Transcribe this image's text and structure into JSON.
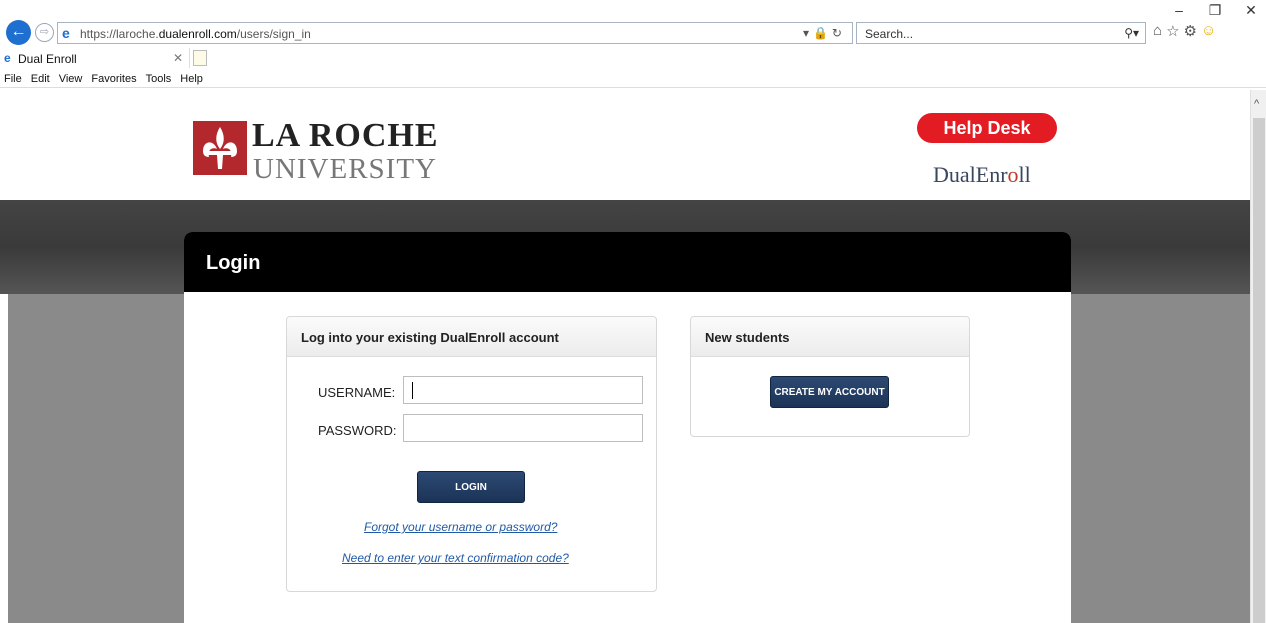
{
  "browser": {
    "url_prefix": "https://laroche.",
    "url_domain": "dualenroll.com",
    "url_path": "/users/sign_in",
    "search_placeholder": "Search...",
    "tab_title": "Dual Enroll",
    "menu": [
      "File",
      "Edit",
      "View",
      "Favorites",
      "Tools",
      "Help"
    ]
  },
  "header": {
    "logo_line1": "LA ROCHE",
    "logo_line2": "UNIVERSITY",
    "help_desk": "Help Desk",
    "brand_prefix": "DualEnr",
    "brand_o": "o",
    "brand_suffix": "ll"
  },
  "login": {
    "title": "Login",
    "panel_title": "Log into your existing DualEnroll account",
    "username_label": "USERNAME:",
    "password_label": "PASSWORD:",
    "username_value": "",
    "password_value": "",
    "login_button": "LOGIN",
    "forgot_link": "Forgot your username or password?",
    "code_link": "Need to enter your text confirmation code?"
  },
  "new_students": {
    "panel_title": "New students",
    "create_button": "CREATE MY ACCOUNT"
  },
  "colors": {
    "help_desk": "#e31b23",
    "button": "#1b3356",
    "link": "#1f5aa6"
  }
}
